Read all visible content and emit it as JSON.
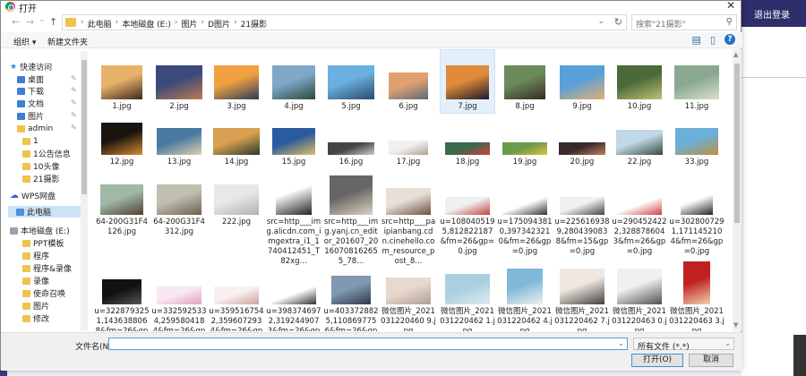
{
  "background": {
    "logout_label": "退出登录"
  },
  "dialog": {
    "title": "打开",
    "close": "✕"
  },
  "nav": {
    "back": "←",
    "forward": "→",
    "down": "⌄",
    "up": "↑",
    "breadcrumb": [
      "此电脑",
      "本地磁盘 (E:)",
      "图片",
      "D图片",
      "21摄影"
    ],
    "search_placeholder": "搜索\"21摄影\""
  },
  "toolbar": {
    "organize": "组织 ▾",
    "new_folder": "新建文件夹"
  },
  "sidebar": {
    "items": [
      {
        "label": "快速访问",
        "icon": "star-icon"
      },
      {
        "label": "桌面",
        "icon": "desktop-icon",
        "pinned": true
      },
      {
        "label": "下载",
        "icon": "download-icon",
        "pinned": true
      },
      {
        "label": "文档",
        "icon": "document-icon",
        "pinned": true
      },
      {
        "label": "图片",
        "icon": "picture-icon",
        "pinned": true
      },
      {
        "label": "admin",
        "icon": "folder-icon",
        "pinned": true
      },
      {
        "label": "1",
        "icon": "folder-icon"
      },
      {
        "label": "1公告信息",
        "icon": "folder-icon"
      },
      {
        "label": "10头像",
        "icon": "folder-icon"
      },
      {
        "label": "21摄影",
        "icon": "folder-icon"
      },
      {
        "label": "WPS网盘",
        "icon": "cloud-icon"
      },
      {
        "label": "此电脑",
        "icon": "computer-icon"
      },
      {
        "label": "本地磁盘 (E:)",
        "icon": "drive-icon"
      },
      {
        "label": "PPT模板",
        "icon": "folder-icon"
      },
      {
        "label": "程序",
        "icon": "folder-icon"
      },
      {
        "label": "程序&录像",
        "icon": "folder-icon"
      },
      {
        "label": "录像",
        "icon": "folder-icon"
      },
      {
        "label": "使命召唤",
        "icon": "folder-icon"
      },
      {
        "label": "图片",
        "icon": "folder-icon"
      },
      {
        "label": "修改",
        "icon": "folder-icon"
      }
    ]
  },
  "files": [
    {
      "name": "1.jpg",
      "colors": [
        "#e8b26a",
        "#3b2a1a"
      ]
    },
    {
      "name": "2.jpg",
      "colors": [
        "#3a4a7a",
        "#c07a50"
      ]
    },
    {
      "name": "3.jpg",
      "colors": [
        "#f0a040",
        "#2a3a5a"
      ]
    },
    {
      "name": "4.jpg",
      "colors": [
        "#7fa8c8",
        "#2c4a3a"
      ]
    },
    {
      "name": "5.jpg",
      "colors": [
        "#6ab0e0",
        "#2a4a6a"
      ]
    },
    {
      "name": "6.jpg",
      "colors": [
        "#e0a070",
        "#5a6a7a"
      ]
    },
    {
      "name": "7.jpg",
      "colors": [
        "#e08a3a",
        "#1a1a2a"
      ]
    },
    {
      "name": "8.jpg",
      "colors": [
        "#6a8a5a",
        "#3a2a20"
      ]
    },
    {
      "name": "9.jpg",
      "colors": [
        "#5aa0d8",
        "#e0b070"
      ]
    },
    {
      "name": "10.jpg",
      "colors": [
        "#4a6a3a",
        "#c0c070"
      ]
    },
    {
      "name": "11.jpg",
      "colors": [
        "#8aa890",
        "#d8e0d0"
      ]
    },
    {
      "name": "12.jpg",
      "colors": [
        "#1a1410",
        "#d88a30"
      ]
    },
    {
      "name": "13.jpg",
      "colors": [
        "#4a7aa0",
        "#e0d0b0"
      ]
    },
    {
      "name": "14.jpg",
      "colors": [
        "#d8a050",
        "#2a3a2a"
      ]
    },
    {
      "name": "15.jpg",
      "colors": [
        "#2a5aa0",
        "#e0c060"
      ]
    },
    {
      "name": "16.jpg",
      "colors": [
        "#444444",
        "#cccccc"
      ]
    },
    {
      "name": "17.jpg",
      "colors": [
        "#f0f0f0",
        "#b0a090"
      ]
    },
    {
      "name": "18.jpg",
      "colors": [
        "#3a6a4a",
        "#d04040"
      ]
    },
    {
      "name": "19.jpg",
      "colors": [
        "#6a9a4a",
        "#e0c040"
      ]
    },
    {
      "name": "20.jpg",
      "colors": [
        "#3a2a2a",
        "#c08060"
      ]
    },
    {
      "name": "22.jpg",
      "colors": [
        "#c0d8e8",
        "#3a4a3a"
      ]
    },
    {
      "name": "33.jpg",
      "colors": [
        "#6ab0d8",
        "#c09040"
      ]
    },
    {
      "name": "64-200G31F4126.jpg",
      "colors": [
        "#a0b8a8",
        "#504030"
      ]
    },
    {
      "name": "64-200G31F4312.jpg",
      "colors": [
        "#c0c0b0",
        "#6a6050"
      ]
    },
    {
      "name": "222.jpg",
      "colors": [
        "#e8e8e8",
        "#b0b0b0"
      ]
    },
    {
      "name": "src=http___img.alicdn.com_imgextra_i1_1740412451_T82xg...",
      "colors": [
        "#ffffff",
        "#222222"
      ]
    },
    {
      "name": "src=http___img.yanj.cn_editor_201607_20160708162655_78...",
      "colors": [
        "#666666",
        "#ddd0c0"
      ]
    },
    {
      "name": "src=http___paipianbang.cdn.cinehello.com_resource_post_8...",
      "colors": [
        "#e8e0d8",
        "#6a5040"
      ]
    },
    {
      "name": "u=1080405195,812822187&fm=26&gp=0.jpg",
      "colors": [
        "#f0f0f0",
        "#c04040"
      ]
    },
    {
      "name": "u=1750943810,3973423210&fm=26&gp=0.jpg",
      "colors": [
        "#ffffff",
        "#333333"
      ]
    },
    {
      "name": "u=2256169389,2804390838&fm=15&gp=0.jpg",
      "colors": [
        "#f0f0f0",
        "#444444"
      ]
    },
    {
      "name": "u=2904524222,3288786043&fm=26&gp=0.jpg",
      "colors": [
        "#ffffff",
        "#d04040"
      ]
    },
    {
      "name": "u=3028007291,1711452104&fm=26&gp=0.jpg",
      "colors": [
        "#ffffff",
        "#222222"
      ]
    },
    {
      "name": "u=3228793251,1436388068&fm=26&gp=0.jpg",
      "colors": [
        "#111111",
        "#555555"
      ]
    },
    {
      "name": "u=3325925334,2595804184&fm=26&gp=0.jpg",
      "colors": [
        "#f8e8f0",
        "#e0a0c0"
      ]
    },
    {
      "name": "u=3595167542,3596072934&fm=26&gp=0.jpg",
      "colors": [
        "#f8f0f0",
        "#d0a0a0"
      ]
    },
    {
      "name": "u=3983746972,3192449073&fm=26&gp=0.jpg",
      "colors": [
        "#ffffff",
        "#333333"
      ]
    },
    {
      "name": "u=4033728825,1108697756&fm=26&gp=0.jpg",
      "colors": [
        "#8098b0",
        "#303848"
      ]
    },
    {
      "name": "微信图片_2021031220460 9.jpg",
      "colors": [
        "#e8d8d0",
        "#b0a090"
      ]
    },
    {
      "name": "微信图片_2021031220462 1.jpg",
      "colors": [
        "#a8d0e0",
        "#e0e8f0"
      ]
    },
    {
      "name": "微信图片_2021031220462 4.jpg",
      "colors": [
        "#80b8d8",
        "#f0f0f0"
      ]
    },
    {
      "name": "微信图片_2021031220462 7.jpg",
      "colors": [
        "#f0e8e0",
        "#404040"
      ]
    },
    {
      "name": "微信图片_2021031220463 0.jpg",
      "colors": [
        "#f0f0f0",
        "#505050"
      ]
    },
    {
      "name": "微信图片_2021031220463 3.jpg",
      "colors": [
        "#c02020",
        "#f0d0b0"
      ]
    }
  ],
  "bottom": {
    "filename_label": "文件名(N):",
    "filename_value": "",
    "filetype_value": "所有文件 (*.*)",
    "open_label": "打开(O)",
    "cancel_label": "取消"
  }
}
